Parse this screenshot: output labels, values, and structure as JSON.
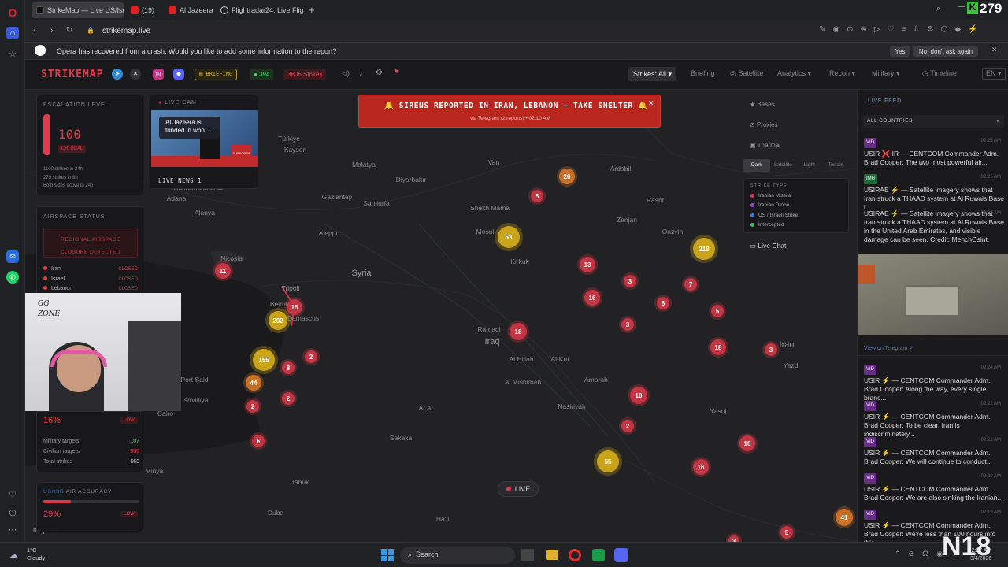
{
  "browser": {
    "tabs": [
      {
        "title": "StrikeMap — Live US/Isra"
      },
      {
        "title": "(19)"
      },
      {
        "title": "Al Jazeera Eng"
      },
      {
        "title": "Flightradar24: Live Flight T"
      }
    ],
    "top_right_count": "279",
    "url": "strikemap.live",
    "crash_message": "Opera has recovered from a crash. Would you like to add some information to the report?",
    "yes_label": "Yes",
    "no_label": "No, don't ask again"
  },
  "app": {
    "logo": "STRIKEMAP",
    "briefing_label": "BRIEFING",
    "count_green": "394",
    "strikes_badge": "3806 Strikes",
    "nav": {
      "strikes": "Strikes: All",
      "briefing": "Briefing",
      "satellite": "Satellite",
      "analytics": "Analytics",
      "recon": "Recon",
      "military": "Military",
      "timeline": "Timeline",
      "lang": "EN"
    }
  },
  "escalation": {
    "title": "ESCALATION LEVEL",
    "value": "100",
    "status": "CRITICAL",
    "lines": [
      "1100 strikes in 24h",
      "279 strikes in 8h",
      "Both sides active in 24h"
    ]
  },
  "live_cam": {
    "title": "LIVE CAM",
    "thumb_text": "Al Jazeera is funded in who...",
    "subscribe": "SUBSCRIBE",
    "channel": "LIVE NEWS 1"
  },
  "airspace": {
    "title": "AIRSPACE STATUS",
    "notice": "REGIONAL AIRSPACE CLOSURE DETECTED",
    "rows": [
      {
        "name": "Iran",
        "status": "CLOSED"
      },
      {
        "name": "Israel",
        "status": "CLOSED"
      },
      {
        "name": "Lebanon",
        "status": "CLOSED"
      }
    ]
  },
  "webcam": {
    "text": "GG ZONE"
  },
  "accuracy": {
    "percent_top": "16%",
    "badge_top": "LOW",
    "rows": [
      {
        "label": "Military targets",
        "value": "107"
      },
      {
        "label": "Civilian targets",
        "value": "556"
      },
      {
        "label": "Total strikes",
        "value": "663"
      }
    ],
    "title2_prefix": "US/ISR",
    "title2": "AIR ACCURACY",
    "percent_bottom": "29%",
    "badge_bottom": "LOW",
    "fill_bottom": 0.29,
    "mapbox": "mapbox",
    "corner_num": "328"
  },
  "alert": {
    "text": "SIRENS REPORTED IN IRAN, LEBANON — TAKE SHELTER",
    "sub": "via Telegram (2 reports) • 02:10 AM"
  },
  "layers": {
    "bases": "Bases",
    "proxies": "Proxies",
    "thermal": "Thermal",
    "styles": [
      "Dark",
      "Satellite",
      "Light",
      "Terrain"
    ],
    "strike_type_title": "STRIKE TYPE",
    "types": [
      {
        "label": "Iranian Missile",
        "color": "#d9364a"
      },
      {
        "label": "Iranian Drone",
        "color": "#9a4ad9"
      },
      {
        "label": "US / Israeli Strike",
        "color": "#3a7ae0"
      },
      {
        "label": "Intercepted",
        "color": "#3ac26a"
      }
    ],
    "live_chat": "Live Chat"
  },
  "map": {
    "live_label": "LIVE",
    "labels": [
      "Türkiye",
      "Kayseri",
      "Van",
      "Ardabil",
      "Malatya",
      "Diyarbakır",
      "Kahramanmaras",
      "Gaziantep",
      "Sanliurfa",
      "Shekh Mama",
      "Rasht",
      "Adana",
      "Aleppo",
      "Mosul",
      "Alanya",
      "Zanjan",
      "Qazvin",
      "Kirkuk",
      "Nicosia",
      "Syria",
      "Tripoli",
      "Beirut",
      "Damascus",
      "Ramadi",
      "Iraq",
      "Al Hillah",
      "Al-Kut",
      "Iran",
      "Yazd",
      "Port Said",
      "Al Mishkhab",
      "Amarah",
      "Ismailiya",
      "Cairo",
      "Ar Ar",
      "Nasiriyah",
      "Yasuj",
      "Sakaka",
      "Tabuk",
      "Minya",
      "Duba",
      "Ha'il"
    ],
    "clusters": [
      "26",
      "5",
      "53",
      "218",
      "11",
      "13",
      "3",
      "7",
      "16",
      "6",
      "15",
      "202",
      "3",
      "5",
      "18",
      "18",
      "3",
      "2",
      "155",
      "8",
      "44",
      "2",
      "2",
      "10",
      "10",
      "2",
      "6",
      "55",
      "16",
      "41",
      "5",
      "3"
    ]
  },
  "feed": {
    "title": "LIVE FEED",
    "filter": "ALL COUNTRIES",
    "view_telegram": "View on Telegram ↗",
    "items": [
      {
        "tag": "VID",
        "time": "02:25 AM",
        "text": "USIR ❌ IR — CENTCOM Commander Adm. Brad Cooper: The two most powerful air..."
      },
      {
        "tag": "IMG",
        "time": "02:25 AM",
        "text": "USIRAE ⚡ — Satellite imagery shows that Iran struck a THAAD system at Al Ruwais Base i..."
      },
      {
        "tag": "",
        "time": "02:25 AM",
        "text": "USIRAE ⚡ — Satellite imagery shows that Iran struck a THAAD system at Al Ruwais Base in the United Arab Emirates, and visible damage can be seen. Credit: MenchOsint."
      },
      {
        "tag": "VID",
        "time": "02:24 AM",
        "text": "USIR ⚡ — CENTCOM Commander Adm. Brad Cooper: Along the way, every single branc..."
      },
      {
        "tag": "VID",
        "time": "02:22 AM",
        "text": "USIR ⚡ — CENTCOM Commander Adm. Brad Cooper: To be clear, Iran is indiscriminately..."
      },
      {
        "tag": "VID",
        "time": "02:21 AM",
        "text": "USIR ⚡ — CENTCOM Commander Adm. Brad Cooper: We will continue to conduct..."
      },
      {
        "tag": "VID",
        "time": "02:20 AM",
        "text": "USIR ⚡ — CENTCOM Commander Adm. Brad Cooper: We are also sinking the Iranian..."
      },
      {
        "tag": "VID",
        "time": "02:19 AM",
        "text": "USIR ⚡ — CENTCOM Commander Adm. Brad Cooper: We're less than 100 hours into this..."
      }
    ]
  },
  "taskbar": {
    "temp": "1°C",
    "weather": "Cloudy",
    "search": "Search",
    "time": "2:27 AM",
    "date": "3/4/2026",
    "overlay": "N18"
  }
}
